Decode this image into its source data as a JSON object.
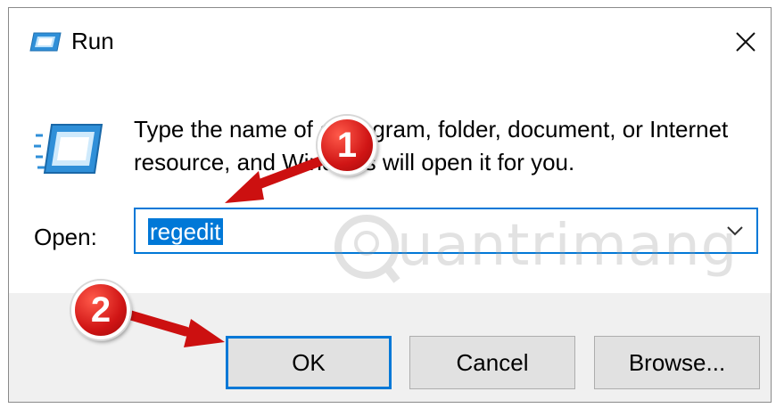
{
  "dialog": {
    "title": "Run",
    "close_symbol": "✕",
    "description": "Type the name of a program, folder, document, or Internet resource, and Windows will open it for you.",
    "open_label": "Open:",
    "open_value": "regedit",
    "buttons": {
      "ok": "OK",
      "cancel": "Cancel",
      "browse": "Browse..."
    }
  },
  "annotations": {
    "step1": "1",
    "step2": "2"
  },
  "watermark": {
    "text": "uantrimang"
  },
  "colors": {
    "accent": "#0078d7",
    "badge": "#d01515",
    "footer": "#f0f0f0"
  },
  "icons": {
    "title_icon": "run-icon",
    "big_icon": "run-icon",
    "dropdown": "chevron-down-icon",
    "close": "close-icon"
  }
}
